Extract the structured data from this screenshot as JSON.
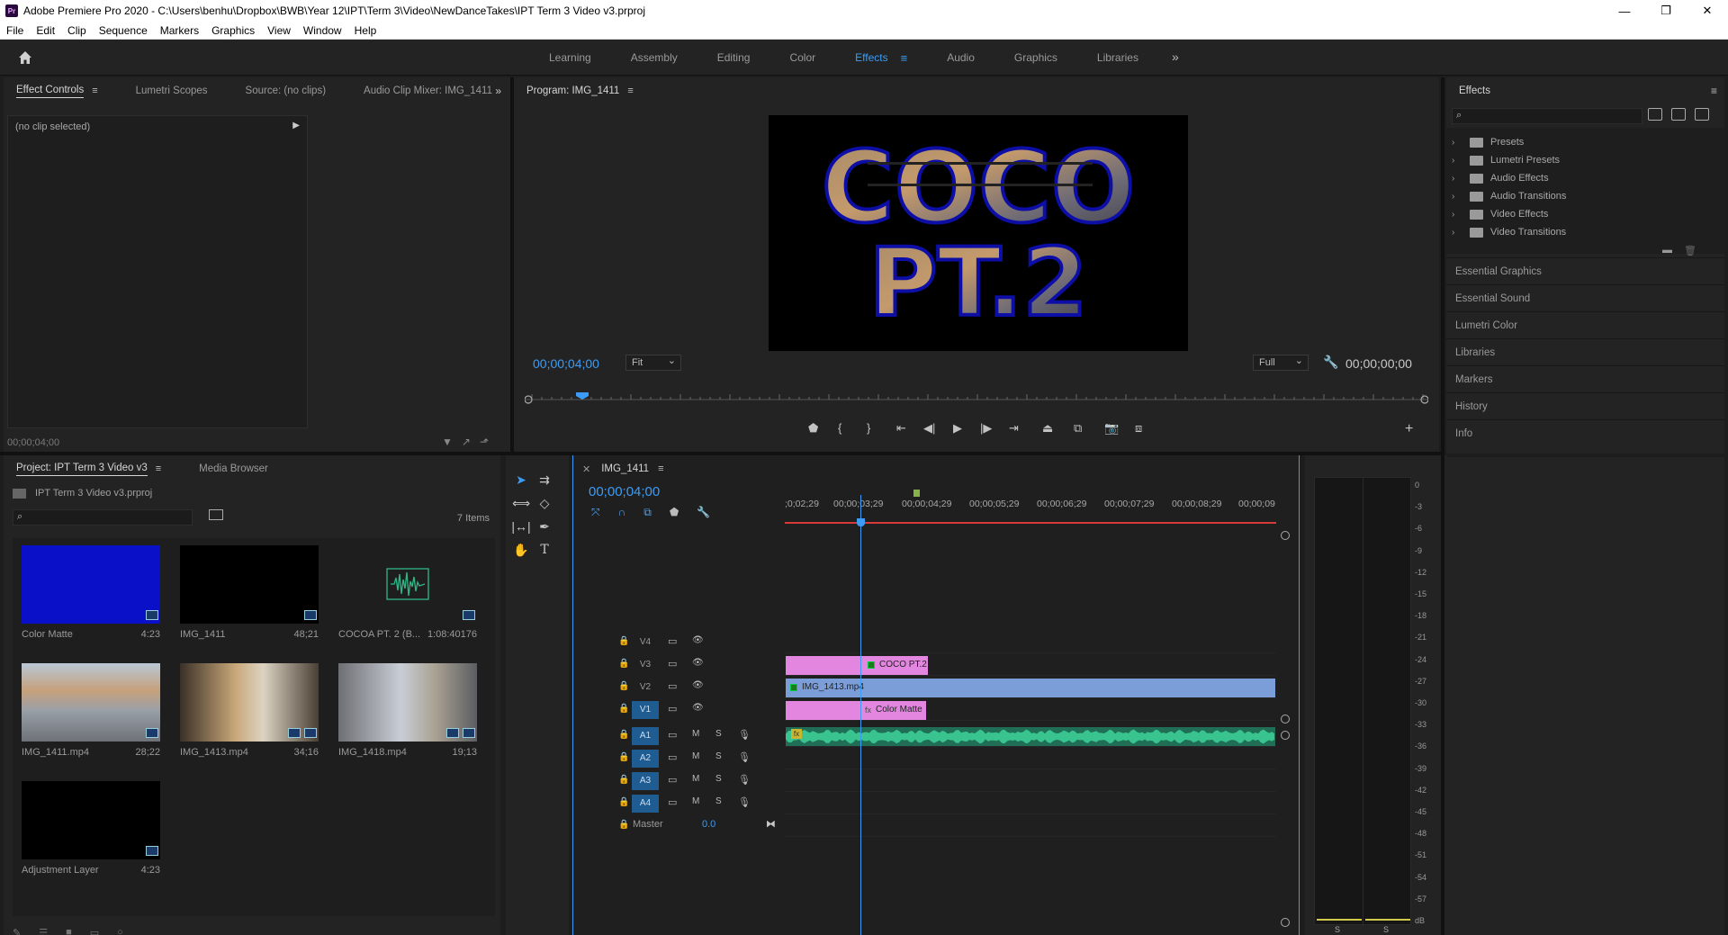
{
  "window": {
    "title": "Adobe Premiere Pro 2020 - C:\\Users\\benhu\\Dropbox\\BWB\\Year 12\\IPT\\Term 3\\Video\\NewDanceTakes\\IPT Term 3 Video v3.prproj",
    "app_icon": "Pr"
  },
  "menu": [
    "File",
    "Edit",
    "Clip",
    "Sequence",
    "Markers",
    "Graphics",
    "View",
    "Window",
    "Help"
  ],
  "workspaces": [
    "Learning",
    "Assembly",
    "Editing",
    "Color",
    "Effects",
    "Audio",
    "Graphics",
    "Libraries"
  ],
  "active_workspace": "Effects",
  "source_panel": {
    "tabs": [
      "Effect Controls",
      "Lumetri Scopes",
      "Source: (no clips)",
      "Audio Clip Mixer: IMG_1411"
    ],
    "no_clip": "(no clip selected)",
    "timecode": "00;00;04;00"
  },
  "program": {
    "tab": "Program: IMG_1411",
    "timecode": "00;00;04;00",
    "fit": "Fit",
    "quality": "Full",
    "duration": "00;00;00;00",
    "frame_text_top": "COCO",
    "frame_text_bottom": "PT.2"
  },
  "effects_panel": {
    "title": "Effects",
    "items": [
      "Presets",
      "Lumetri Presets",
      "Audio Effects",
      "Audio Transitions",
      "Video Effects",
      "Video Transitions"
    ],
    "sections": [
      "Essential Graphics",
      "Essential Sound",
      "Lumetri Color",
      "Libraries",
      "Markers",
      "History",
      "Info"
    ]
  },
  "project": {
    "tabs": [
      "Project: IPT Term 3 Video v3",
      "Media Browser"
    ],
    "path": "IPT Term 3 Video v3.prproj",
    "count": "7 Items",
    "items": [
      {
        "name": "Color Matte",
        "duration": "4:23",
        "thumb": "#0a10c8"
      },
      {
        "name": "IMG_1411",
        "duration": "48;21",
        "thumb": "#000000"
      },
      {
        "name": "COCOA PT. 2 (B...",
        "duration": "1:08:40176",
        "thumb": "#232323"
      },
      {
        "name": "IMG_1411.mp4",
        "duration": "28;22",
        "thumb": "#8b8f93"
      },
      {
        "name": "IMG_1413.mp4",
        "duration": "34;16",
        "thumb": "#807060"
      },
      {
        "name": "IMG_1418.mp4",
        "duration": "19;13",
        "thumb": "#777b80"
      },
      {
        "name": "Adjustment Layer",
        "duration": "4:23",
        "thumb": "#000000"
      }
    ]
  },
  "timeline": {
    "tab": "IMG_1411",
    "timecode": "00;00;04;00",
    "ruler": [
      ";0;02;29",
      "00;00;03;29",
      "00;00;04;29",
      "00;00;05;29",
      "00;00;06;29",
      "00;00;07;29",
      "00;00;08;29",
      "00;00;09"
    ],
    "video_tracks": [
      "V4",
      "V3",
      "V2",
      "V1"
    ],
    "audio_tracks": [
      "A1",
      "A2",
      "A3",
      "A4"
    ],
    "master_label": "Master",
    "master_value": "0.0",
    "mute": "M",
    "solo": "S",
    "clips": {
      "v3": "COCO PT.2",
      "v2": "IMG_1413.mp4",
      "v1": "Color Matte",
      "a1_fx": "fx",
      "v1_fx": "fx"
    }
  },
  "meters": {
    "scale": [
      "0",
      "-3",
      "-6",
      "-9",
      "-12",
      "-15",
      "-18",
      "-21",
      "-24",
      "-27",
      "-30",
      "-33",
      "-36",
      "-39",
      "-42",
      "-45",
      "-48",
      "-51",
      "-54",
      "-57",
      "dB"
    ],
    "solo_left": "S",
    "solo_right": "S"
  },
  "colors": {
    "accent": "#3c9cf5",
    "clip_pink": "#e386e0",
    "clip_blue": "#7b9ed9",
    "audio_green": "#2fb887"
  }
}
